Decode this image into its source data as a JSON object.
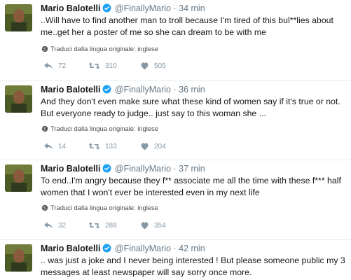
{
  "tweets": [
    {
      "name": "Mario Balotelli",
      "handle": "@FinallyMario",
      "separator": "·",
      "time": "34 min",
      "lines": [
        "..Will have to find another man to troll because I'm tired of this bul**lies about",
        "me..get her a poster of me so she can dream to be with me"
      ],
      "translate": "Traduci dalla lingua originale: inglese",
      "replies": "72",
      "retweets": "310",
      "likes": "505"
    },
    {
      "name": "Mario Balotelli",
      "handle": "@FinallyMario",
      "separator": "·",
      "time": "36 min",
      "lines": [
        "And they don't even make sure what these kind of women say if it's true or not.",
        "But everyone ready to judge.. just say to this woman she ..."
      ],
      "translate": "Traduci dalla lingua originale: inglese",
      "replies": "14",
      "retweets": "133",
      "likes": "204"
    },
    {
      "name": "Mario Balotelli",
      "handle": "@FinallyMario",
      "separator": "·",
      "time": "37 min",
      "lines": [
        "To end..I'm angry because they f** associate me all the time with these f*** half",
        "women that I won't ever be interested even in my next life"
      ],
      "translate": "Traduci dalla lingua originale: inglese",
      "replies": "32",
      "retweets": "288",
      "likes": "354"
    },
    {
      "name": "Mario Balotelli",
      "handle": "@FinallyMario",
      "separator": "·",
      "time": "42 min",
      "lines": [
        ".. was just a joke and I never being interested ! But please someone public my 3",
        "messages at least newspaper will say sorry once more."
      ],
      "translate": "",
      "replies": "",
      "retweets": "",
      "likes": ""
    }
  ],
  "icons": {
    "avatar": "profile-photo",
    "verified": "verified-badge-icon",
    "globe": "globe-icon",
    "reply": "reply-icon",
    "retweet": "retweet-icon",
    "like": "heart-icon"
  },
  "colors": {
    "verified": "#1da1f2",
    "meta_text": "#657786",
    "action_text": "#8899a6",
    "divider": "#e6ecf0"
  }
}
